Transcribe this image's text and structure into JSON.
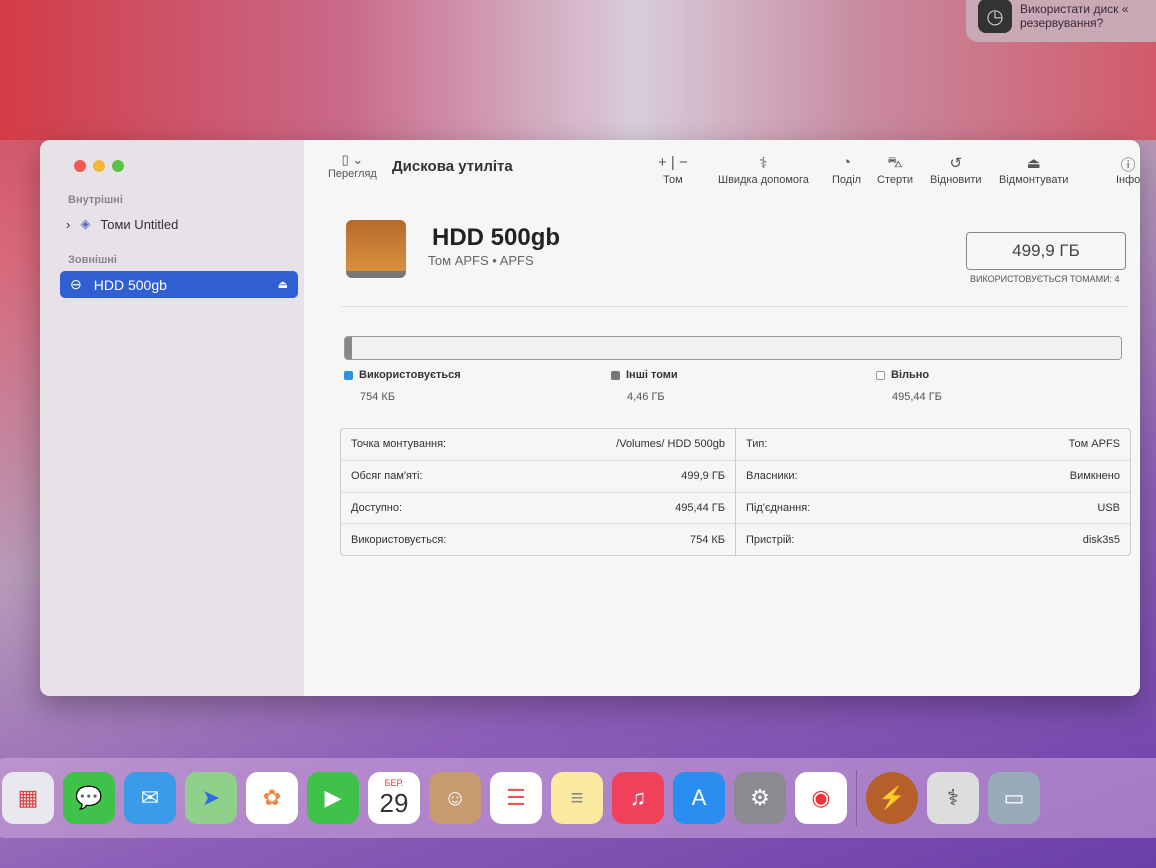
{
  "notification": {
    "line1": "Використати диск «",
    "line2": "резервування?",
    "icon": "time-machine-icon"
  },
  "app": {
    "title": "Дискова утиліта",
    "view_label": "Перегляд"
  },
  "sidebar": {
    "internal_label": "Внутрішні",
    "internal_items": [
      {
        "label": "Томи Untitled",
        "icon": "layers-icon"
      }
    ],
    "external_label": "Зовнішні",
    "external_items": [
      {
        "label": "HDD 500gb",
        "icon": "drive-icon",
        "selected": true
      }
    ]
  },
  "toolbar": [
    {
      "label": "Том",
      "glyph": "+ | −"
    },
    {
      "label": "Швидка допомога",
      "glyph": "⚕"
    },
    {
      "label": "Поділ",
      "glyph": "◔"
    },
    {
      "label": "Стерти",
      "glyph": "⛍"
    },
    {
      "label": "Відновити",
      "glyph": "↺"
    },
    {
      "label": "Відмонтувати",
      "glyph": "⏏"
    },
    {
      "label": "Інфо",
      "glyph": "ⓘ"
    }
  ],
  "disk": {
    "name": "HDD 500gb",
    "subtitle": "Том APFS • APFS",
    "capacity": "499,9 ГБ",
    "capacity_label": "ВИКОРИСТОВУЄТЬСЯ ТОМАМИ: 4",
    "used_fraction": 0.009
  },
  "legend": [
    {
      "label": "Використовується",
      "value": "754 КБ",
      "color": "#2f8fe0"
    },
    {
      "label": "Інші томи",
      "value": "4,46 ГБ",
      "color": "#777777"
    },
    {
      "label": "Вільно",
      "value": "495,44 ГБ",
      "color": "#ffffff"
    }
  ],
  "info_left": [
    {
      "k": "Точка монтування:",
      "v": "/Volumes/ HDD 500gb"
    },
    {
      "k": "Обсяг пам'яті:",
      "v": "499,9 ГБ"
    },
    {
      "k": "Доступно:",
      "v": "495,44 ГБ"
    },
    {
      "k": "Використовується:",
      "v": "754 КБ"
    }
  ],
  "info_right": [
    {
      "k": "Тип:",
      "v": "Том APFS"
    },
    {
      "k": "Власники:",
      "v": "Вимкнено"
    },
    {
      "k": "Під'єднання:",
      "v": "USB"
    },
    {
      "k": "Пристрій:",
      "v": "disk3s5"
    }
  ],
  "dock": {
    "calendar_month": "БЕР.",
    "calendar_day": "29"
  }
}
